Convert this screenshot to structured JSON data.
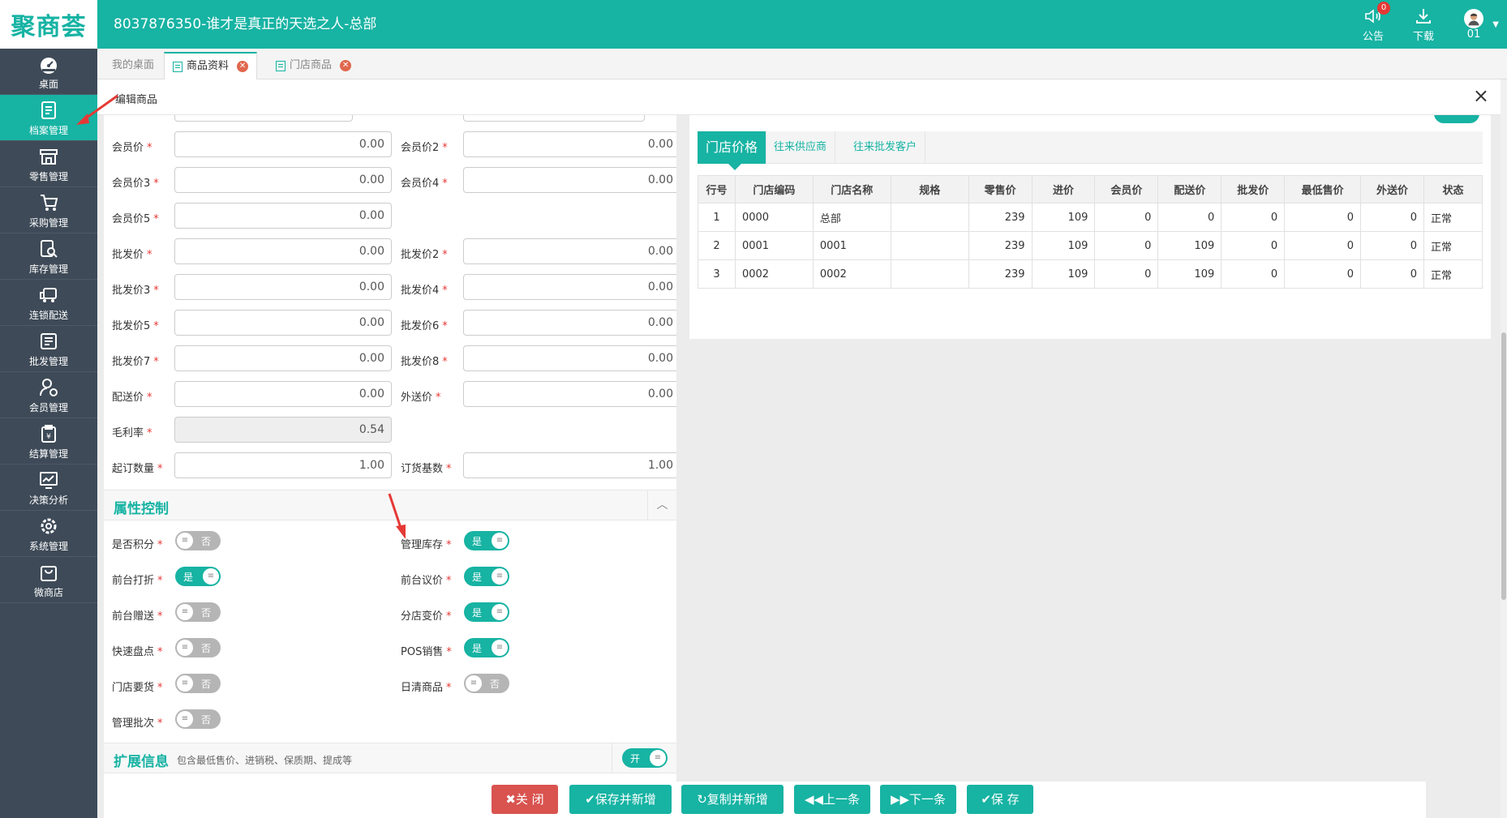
{
  "app": {
    "logo": "聚商荟",
    "title": "8037876350-谁才是真正的天选之人-总部",
    "actions": [
      {
        "label": "公告",
        "badge": "0"
      },
      {
        "label": "下载"
      },
      {
        "label": "01"
      }
    ]
  },
  "sidebar": {
    "items": [
      {
        "label": "桌面",
        "icon": "dashboard-icon"
      },
      {
        "label": "档案管理",
        "icon": "document-icon"
      },
      {
        "label": "零售管理",
        "icon": "store-icon"
      },
      {
        "label": "采购管理",
        "icon": "cart-icon"
      },
      {
        "label": "库存管理",
        "icon": "inventory-icon"
      },
      {
        "label": "连锁配送",
        "icon": "truck-icon"
      },
      {
        "label": "批发管理",
        "icon": "wholesale-icon"
      },
      {
        "label": "会员管理",
        "icon": "member-icon"
      },
      {
        "label": "结算管理",
        "icon": "settlement-icon"
      },
      {
        "label": "决策分析",
        "icon": "analysis-icon"
      },
      {
        "label": "系统管理",
        "icon": "gear-icon"
      },
      {
        "label": "微商店",
        "icon": "shop-bag-icon"
      }
    ]
  },
  "tabs": [
    {
      "label": "我的桌面"
    },
    {
      "label": "商品资料"
    },
    {
      "label": "门店商品"
    }
  ],
  "editor": {
    "title": "编辑商品",
    "close": "×"
  },
  "prices": {
    "member1": {
      "label": "会员价",
      "value": "0.00"
    },
    "member2": {
      "label": "会员价2",
      "value": "0.00"
    },
    "member3": {
      "label": "会员价3",
      "value": "0.00"
    },
    "member4": {
      "label": "会员价4",
      "value": "0.00"
    },
    "member5": {
      "label": "会员价5",
      "value": "0.00"
    },
    "wholesale1": {
      "label": "批发价",
      "value": "0.00"
    },
    "wholesale2": {
      "label": "批发价2",
      "value": "0.00"
    },
    "wholesale3": {
      "label": "批发价3",
      "value": "0.00"
    },
    "wholesale4": {
      "label": "批发价4",
      "value": "0.00"
    },
    "wholesale5": {
      "label": "批发价5",
      "value": "0.00"
    },
    "wholesale6": {
      "label": "批发价6",
      "value": "0.00"
    },
    "wholesale7": {
      "label": "批发价7",
      "value": "0.00"
    },
    "wholesale8": {
      "label": "批发价8",
      "value": "0.00"
    },
    "delivery": {
      "label": "配送价",
      "value": "0.00"
    },
    "external": {
      "label": "外送价",
      "value": "0.00"
    },
    "margin": {
      "label": "毛利率",
      "value": "0.54"
    },
    "min_order": {
      "label": "起订数量",
      "value": "1.00"
    },
    "order_base": {
      "label": "订货基数",
      "value": "1.00"
    }
  },
  "attributes": {
    "title": "属性控制",
    "items": [
      {
        "label": "是否积分",
        "state": "否"
      },
      {
        "label": "管理库存",
        "state": "是"
      },
      {
        "label": "前台打折",
        "state": "是"
      },
      {
        "label": "前台议价",
        "state": "是"
      },
      {
        "label": "前台赠送",
        "state": "否"
      },
      {
        "label": "分店变价",
        "state": "是"
      },
      {
        "label": "快速盘点",
        "state": "否"
      },
      {
        "label": "POS销售",
        "state": "是"
      },
      {
        "label": "门店要货",
        "state": "否"
      },
      {
        "label": "日清商品",
        "state": "否"
      },
      {
        "label": "管理批次",
        "state": "否"
      }
    ]
  },
  "extended": {
    "title": "扩展信息",
    "subtitle": "包含最低售价、进销税、保质期、提成等",
    "toggle": "开"
  },
  "other_info": {
    "subtabs": [
      {
        "label": "门店价格"
      },
      {
        "label": "往来供应商"
      },
      {
        "label": "往来批发客户"
      }
    ],
    "headers": [
      "行号",
      "门店编码",
      "门店名称",
      "规格",
      "零售价",
      "进价",
      "会员价",
      "配送价",
      "批发价",
      "最低售价",
      "外送价",
      "状态"
    ],
    "rows": [
      [
        "1",
        "0000",
        "总部",
        "",
        "239",
        "109",
        "0",
        "0",
        "0",
        "0",
        "0",
        "正常"
      ],
      [
        "2",
        "0001",
        "0001",
        "",
        "239",
        "109",
        "0",
        "109",
        "0",
        "0",
        "0",
        "正常"
      ],
      [
        "3",
        "0002",
        "0002",
        "",
        "239",
        "109",
        "0",
        "109",
        "0",
        "0",
        "0",
        "正常"
      ]
    ]
  },
  "buttons": {
    "close": "✖关 闭",
    "save_new": "✔保存并新增",
    "copy_new": "↻复制并新增",
    "prev": "◀◀上一条",
    "next": "▶▶下一条",
    "save": "✔保 存"
  },
  "colors": {
    "brand": "#17b3a3",
    "sidebar": "#3e4a57",
    "danger": "#d9534f"
  }
}
